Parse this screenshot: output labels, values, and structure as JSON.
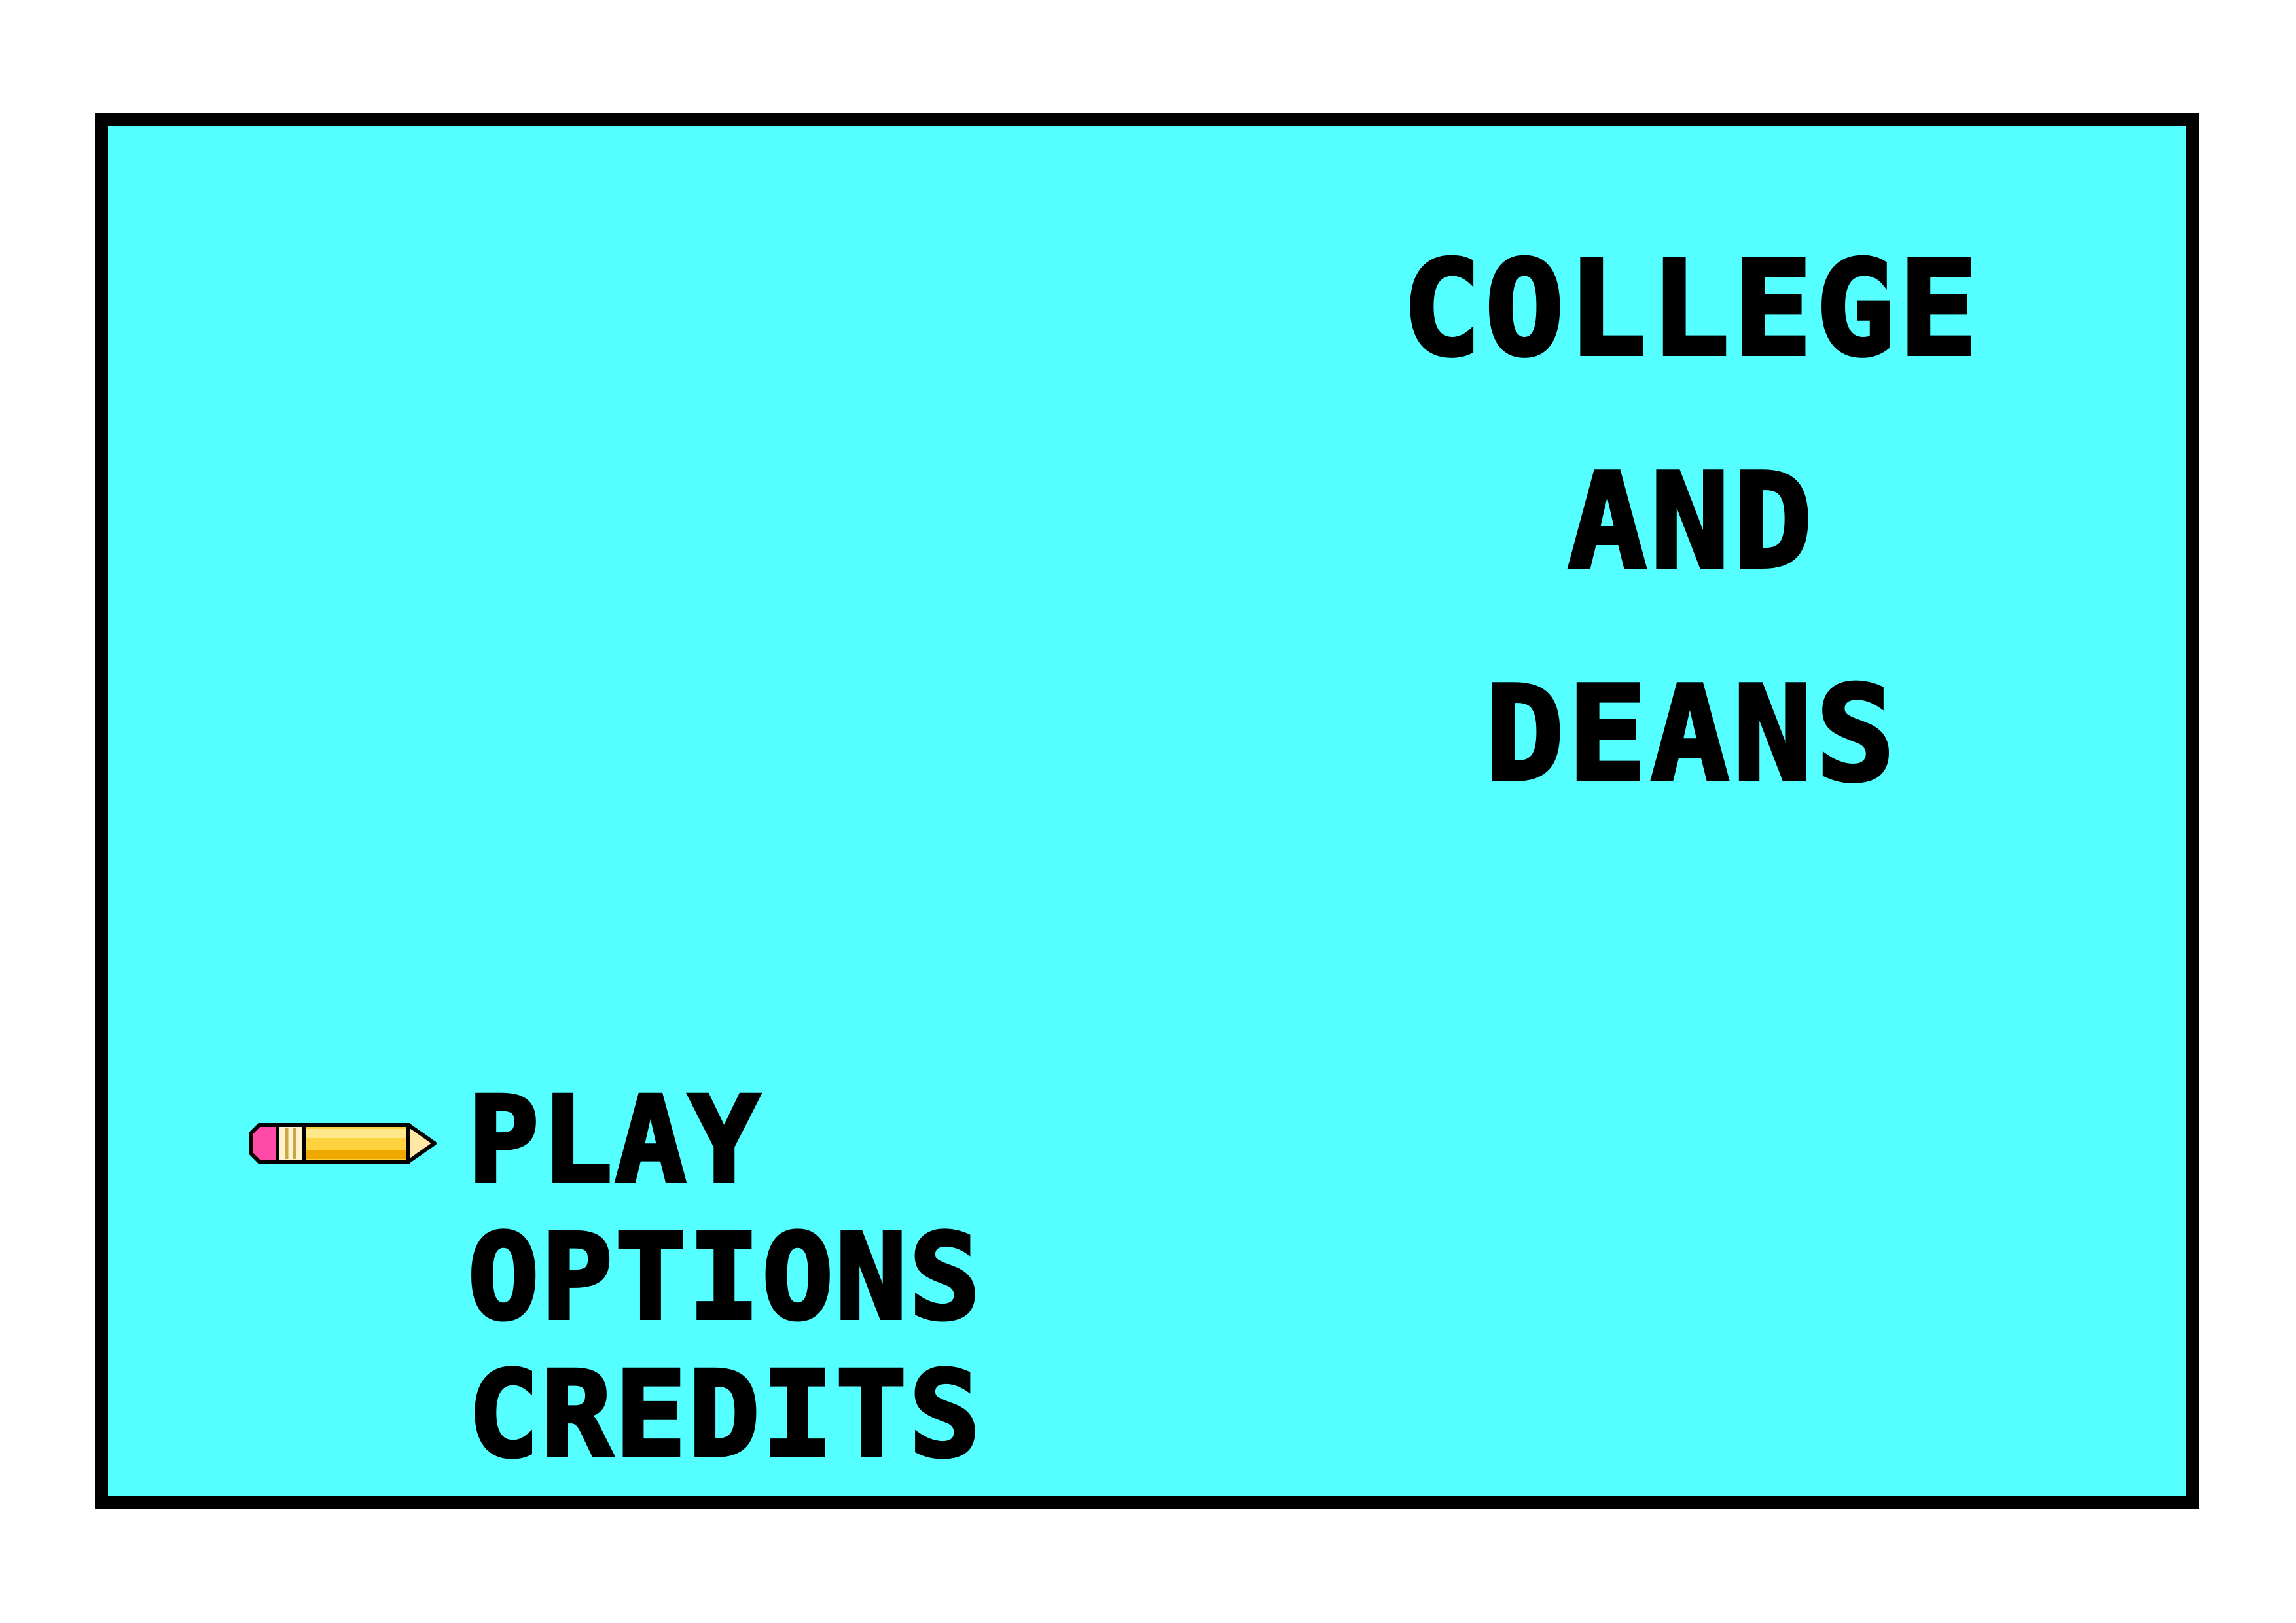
{
  "title": {
    "lines": [
      "COLLEGE",
      "AND",
      "DEANS"
    ]
  },
  "menu": {
    "items": [
      {
        "label": "PLAY",
        "selected": true
      },
      {
        "label": "OPTIONS",
        "selected": false
      },
      {
        "label": "CREDITS",
        "selected": false
      }
    ],
    "cursor_icon": "pencil-icon"
  },
  "colors": {
    "screen_background": "#55ffff",
    "border": "#000000",
    "text": "#000000",
    "pencil_body": "#ffd23f",
    "pencil_eraser": "#ff4aa8",
    "pencil_tip": "#ffe7a6"
  }
}
